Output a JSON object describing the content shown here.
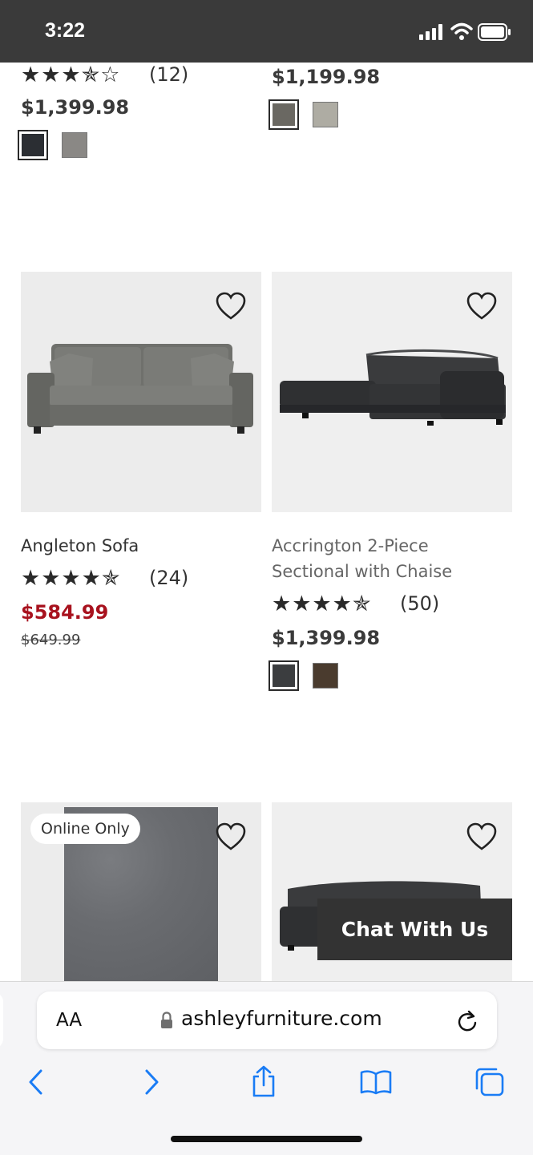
{
  "status_bar": {
    "time": "3:22"
  },
  "top_row": {
    "left": {
      "stars": "★★★✯☆",
      "rating_count": "(12)",
      "price": "$1,399.98",
      "swatches": [
        "#2b2e33",
        "#8a8885"
      ]
    },
    "right": {
      "price": "$1,199.98",
      "swatches": [
        "#6a6862",
        "#aeaca3"
      ]
    }
  },
  "products": [
    {
      "name": "Angleton Sofa",
      "stars": "★★★★✯",
      "rating_count": "(24)",
      "price": "$584.99",
      "old_price": "$649.99"
    },
    {
      "name_line1": "Accrington 2-Piece",
      "name_line2": "Sectional with Chaise",
      "stars": "★★★★✯",
      "rating_count": "(50)",
      "price": "$1,399.98",
      "swatches": [
        "#3b3d3f",
        "#4a3b2e"
      ]
    }
  ],
  "bottom_row": {
    "badge": "Online Only"
  },
  "chat": {
    "label": "Chat With Us"
  },
  "browser": {
    "aa_label": "AA",
    "url": "ashleyfurniture.com"
  },
  "colors": {
    "sale": "#a8121e",
    "chrome_blue": "#1a7cf5",
    "dark": "#333333"
  },
  "icons": [
    "heart-icon",
    "lock-icon",
    "reload-icon",
    "back-icon",
    "forward-icon",
    "share-icon",
    "bookmarks-icon",
    "tabs-icon",
    "signal-icon",
    "wifi-icon",
    "battery-icon"
  ]
}
